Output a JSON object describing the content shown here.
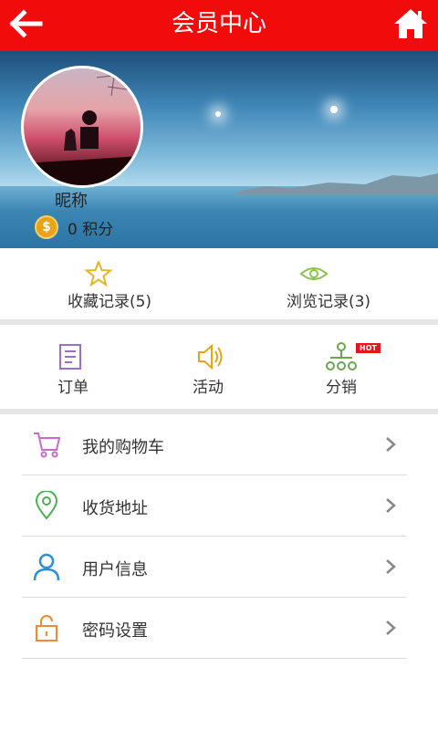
{
  "header": {
    "title": "会员中心",
    "back_icon": "arrow-left-icon",
    "home_icon": "home-icon",
    "bg": "#f20b0b"
  },
  "profile": {
    "nickname": "昵称",
    "points_value": "0",
    "points_label": "积分",
    "coin_icon": "coin-icon",
    "coin_glyph": "$"
  },
  "quick_stats": [
    {
      "label": "收藏记录(5)",
      "icon": "star-icon"
    },
    {
      "label": "浏览记录(3)",
      "icon": "eye-icon"
    }
  ],
  "shortcuts": [
    {
      "label": "订单",
      "icon": "order-icon"
    },
    {
      "label": "活动",
      "icon": "speaker-icon"
    },
    {
      "label": "分销",
      "icon": "distribution-icon",
      "badge": "HOT"
    }
  ],
  "menu": [
    {
      "label": "我的购物车",
      "icon": "cart-icon",
      "color": "#c86ad0"
    },
    {
      "label": "收货地址",
      "icon": "location-pin-icon",
      "color": "#4caf50"
    },
    {
      "label": "用户信息",
      "icon": "user-icon",
      "color": "#2b8fd6"
    },
    {
      "label": "密码设置",
      "icon": "lock-icon",
      "color": "#f08a2c"
    }
  ]
}
